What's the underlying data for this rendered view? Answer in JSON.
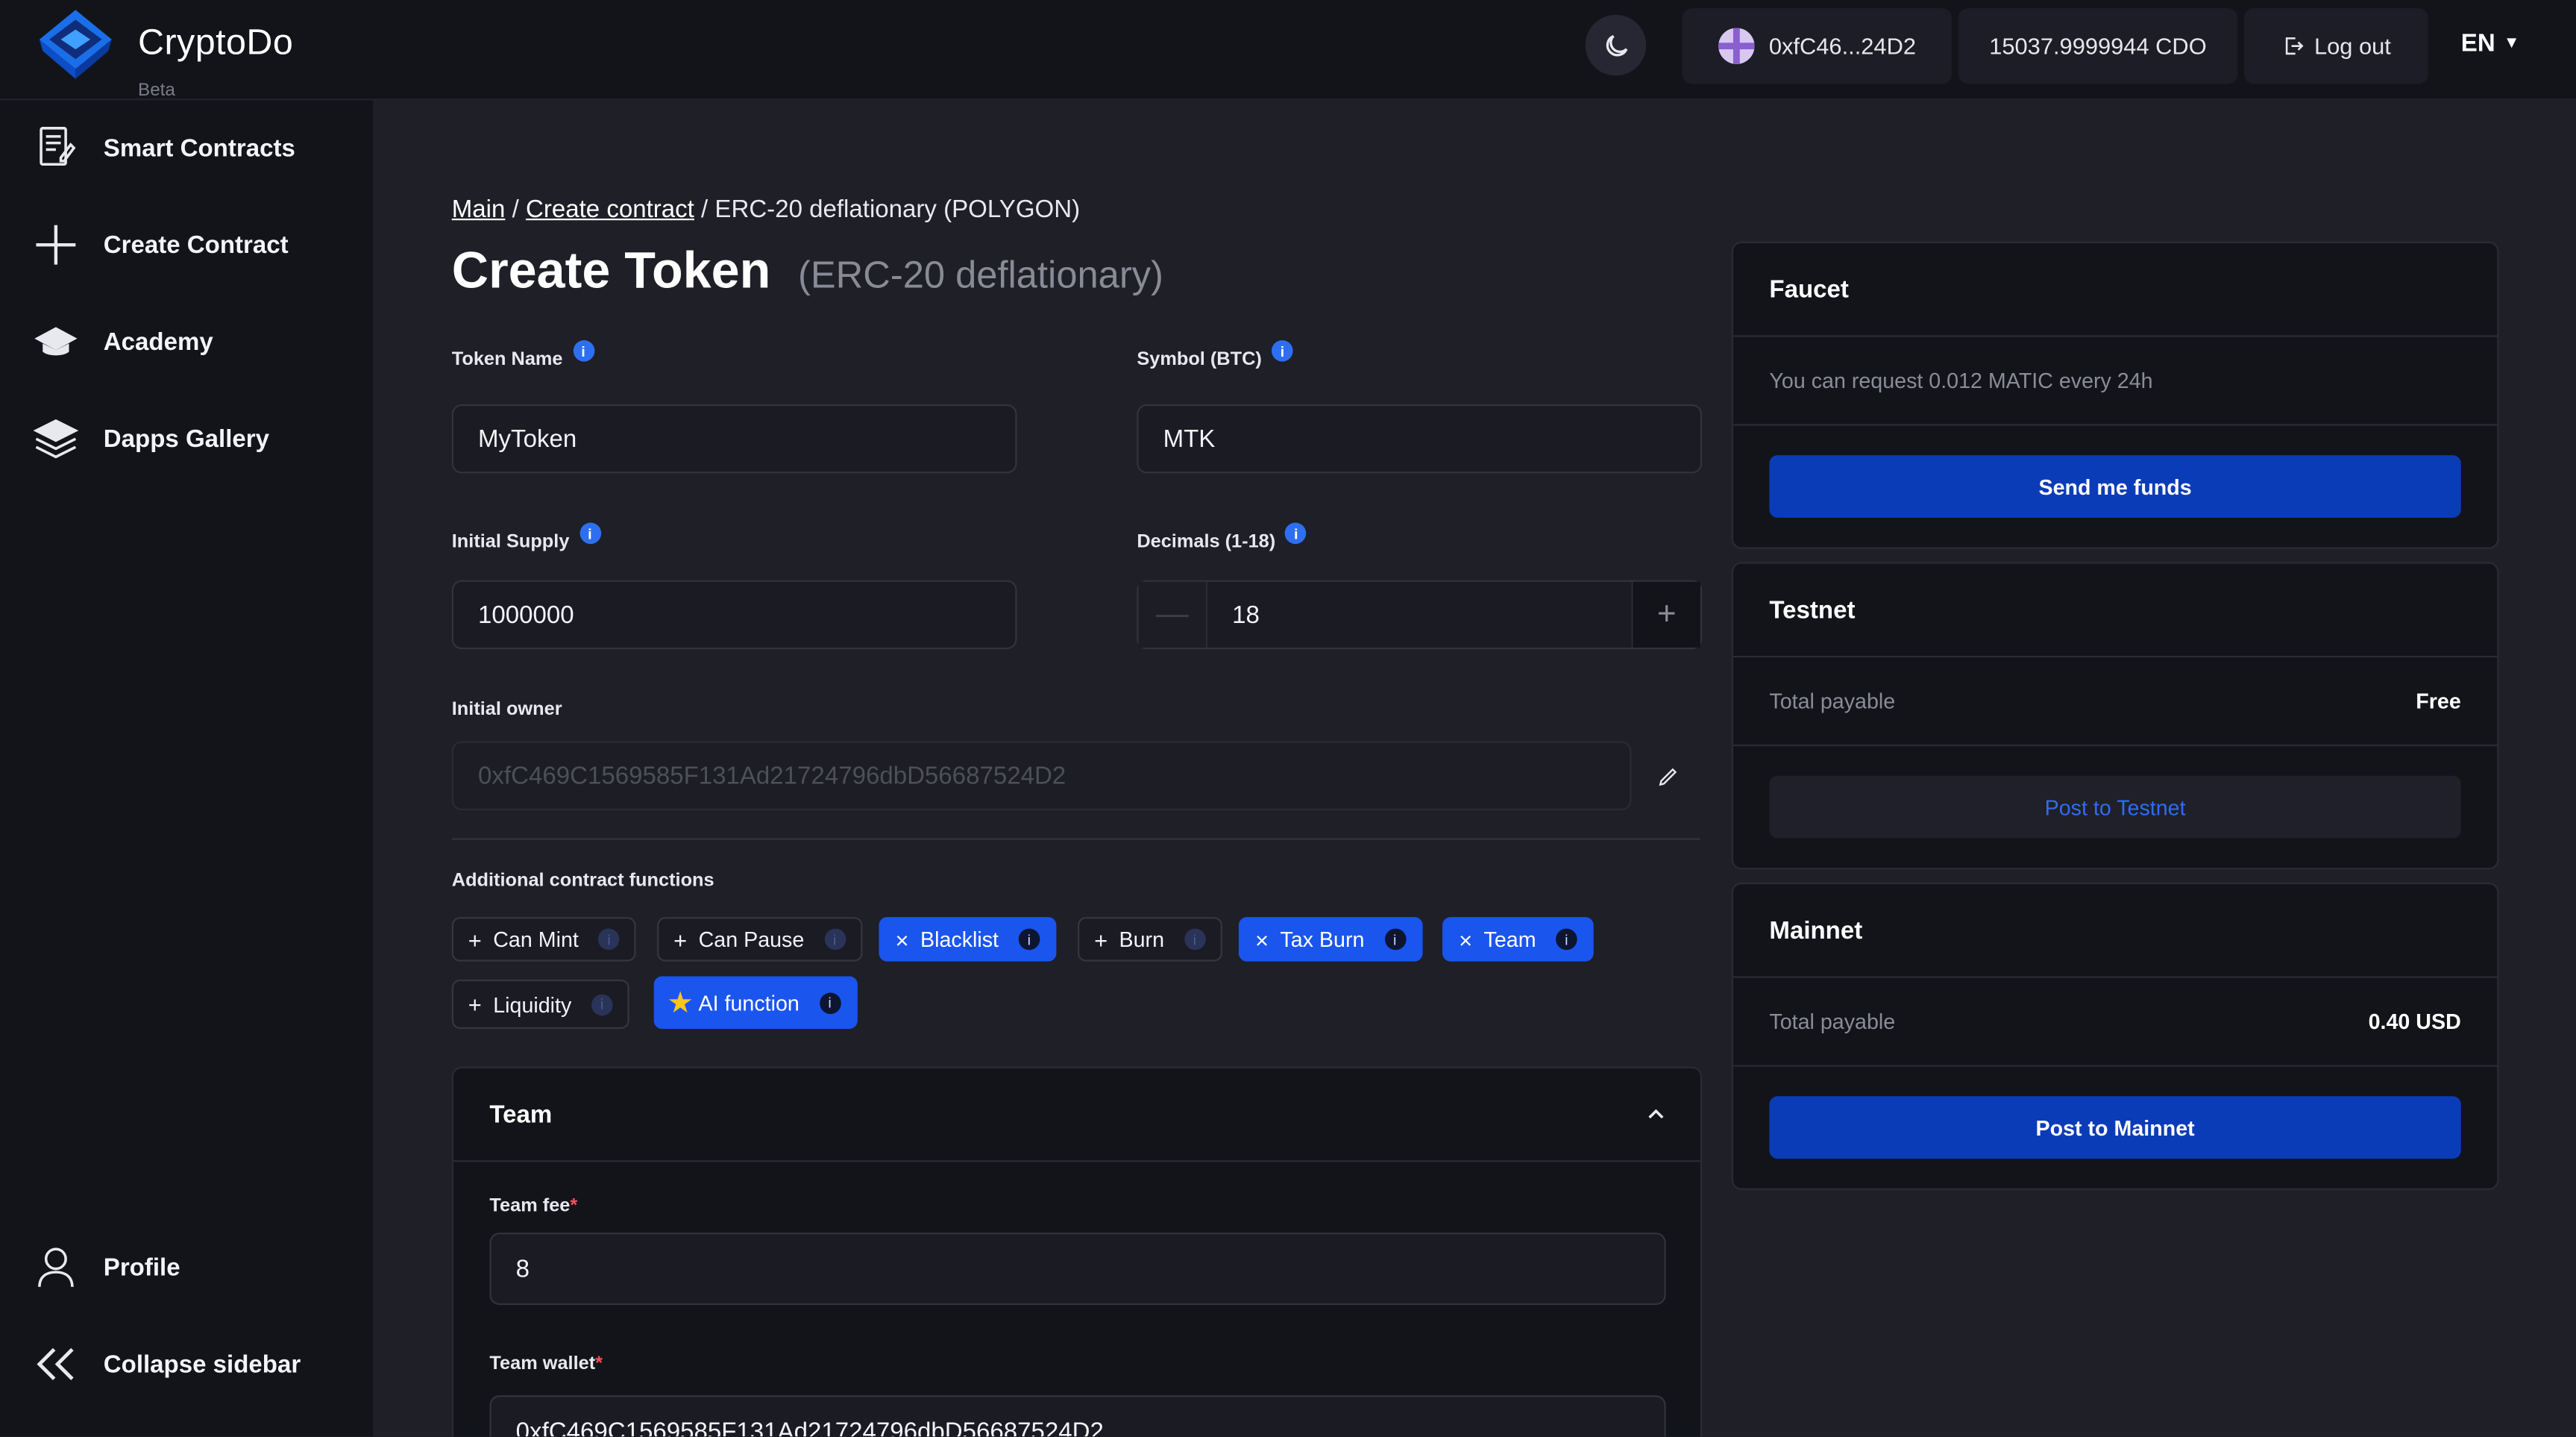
{
  "header": {
    "logo_title": "CryptoDo",
    "logo_beta": "Beta",
    "wallet_address": "0xfC46...24D2",
    "balance": "15037.9999944 CDO",
    "logout_label": "Log out",
    "language": "EN"
  },
  "sidebar": {
    "items": [
      {
        "label": "Smart Contracts",
        "icon": "contract-icon"
      },
      {
        "label": "Create Contract",
        "icon": "plus-icon"
      },
      {
        "label": "Academy",
        "icon": "graduation-cap-icon"
      },
      {
        "label": "Dapps Gallery",
        "icon": "layers-icon"
      }
    ],
    "profile_label": "Profile",
    "collapse_label": "Collapse sidebar"
  },
  "breadcrumb": {
    "main": "Main",
    "create": "Create contract",
    "current": "ERC-20 deflationary (POLYGON)",
    "sep": "/"
  },
  "page": {
    "title": "Create Token",
    "subtitle": "(ERC-20 deflationary)"
  },
  "form": {
    "token_name_label": "Token Name",
    "token_name_value": "MyToken",
    "symbol_label": "Symbol (BTC)",
    "symbol_value": "MTK",
    "initial_supply_label": "Initial Supply",
    "initial_supply_value": "1000000",
    "decimals_label": "Decimals (1-18)",
    "decimals_value": "18",
    "owner_label": "Initial owner",
    "owner_value": "0xfC469C1569585F131Ad21724796dbD56687524D2",
    "functions_label": "Additional contract functions",
    "info_glyph": "i",
    "functions": [
      {
        "label": "Can Mint",
        "active": false
      },
      {
        "label": "Can Pause",
        "active": false
      },
      {
        "label": "Blacklist",
        "active": true
      },
      {
        "label": "Burn",
        "active": false
      },
      {
        "label": "Tax Burn",
        "active": true
      },
      {
        "label": "Team",
        "active": true
      },
      {
        "label": "Liquidity",
        "active": false
      },
      {
        "label": "AI function",
        "active": true,
        "star": true
      }
    ]
  },
  "team": {
    "title": "Team",
    "fee_label": "Team fee",
    "fee_value": "8",
    "wallet_label": "Team wallet",
    "wallet_value": "0xfC469C1569585F131Ad21724796dbD56687524D2",
    "required_mark": "*"
  },
  "faucet": {
    "title": "Faucet",
    "description": "You can request 0.012 MATIC every 24h",
    "button": "Send me funds"
  },
  "testnet": {
    "title": "Testnet",
    "total_label": "Total payable",
    "total_value": "Free",
    "button": "Post to Testnet"
  },
  "mainnet": {
    "title": "Mainnet",
    "total_label": "Total payable",
    "total_value": "0.40 USD",
    "button": "Post to Mainnet"
  },
  "colors": {
    "accent": "#1a55ee",
    "primary_button": "#0b3cb8",
    "background": "#1e1f27",
    "panel": "#13141a"
  }
}
